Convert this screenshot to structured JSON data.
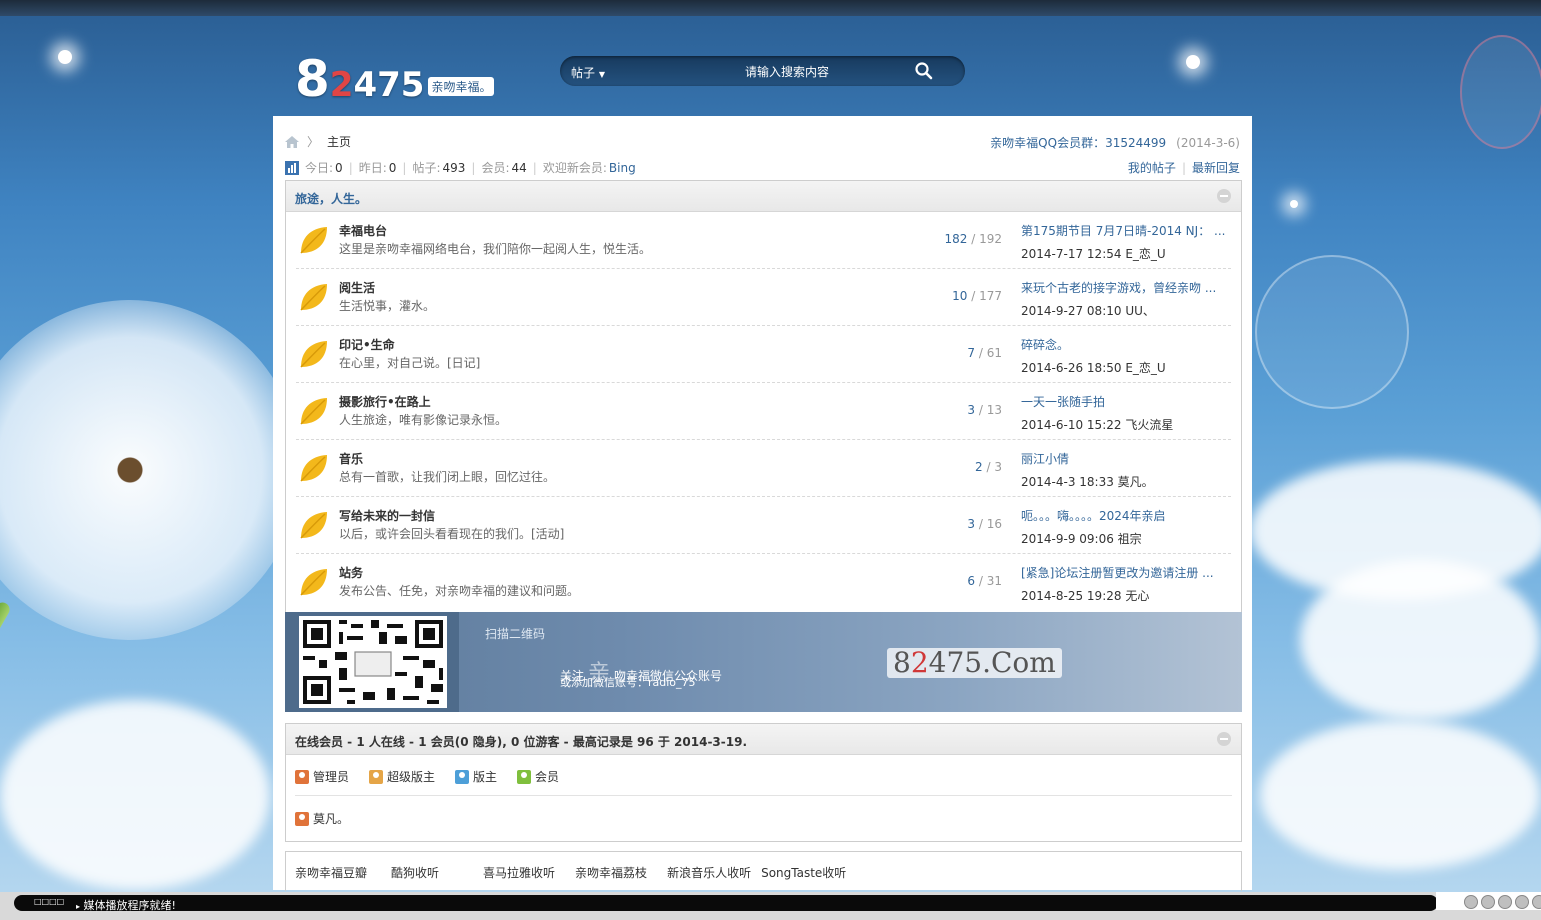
{
  "logo": {
    "digit_big": "8",
    "digit_red": "2",
    "digits_rest": "475",
    "tagline": "亲吻幸福。"
  },
  "search": {
    "type_label": "帖子",
    "placeholder": "请输入搜索内容"
  },
  "breadcrumb": {
    "home_label": "主页"
  },
  "qq_group": {
    "text": "亲吻幸福QQ会员群：31524499",
    "date": "(2014-3-6)"
  },
  "stats": {
    "today_label": "今日:",
    "today": "0",
    "yesterday_label": "昨日:",
    "yesterday": "0",
    "posts_label": "帖子:",
    "posts": "493",
    "members_label": "会员:",
    "members": "44",
    "welcome_label": "欢迎新会员:",
    "newest": "Bing"
  },
  "user_links": {
    "my_posts": "我的帖子",
    "latest_replies": "最新回复"
  },
  "category": {
    "title": "旅途，人生。",
    "forums": [
      {
        "name": "幸福电台",
        "desc": "这里是亲吻幸福网络电台，我们陪你一起阅人生，悦生活。",
        "threads": "182",
        "posts": "192",
        "last_title": "第175期节目 7月7日晴-2014 NJ： ...",
        "last_info": "2014-7-17 12:54 E_恋_U"
      },
      {
        "name": "阅生活",
        "desc": "生活悦事，灌水。",
        "threads": "10",
        "posts": "177",
        "last_title": "来玩个古老的接字游戏，曾经亲吻 ...",
        "last_info": "2014-9-27 08:10 UU、"
      },
      {
        "name": "印记•生命",
        "desc": "在心里，对自己说。[日记]",
        "threads": "7",
        "posts": "61",
        "last_title": "碎碎念。",
        "last_info": "2014-6-26 18:50 E_恋_U"
      },
      {
        "name": "摄影旅行•在路上",
        "desc": "人生旅途，唯有影像记录永恒。",
        "threads": "3",
        "posts": "13",
        "last_title": "一天一张随手拍",
        "last_info": "2014-6-10 15:22 飞火流星"
      },
      {
        "name": "音乐",
        "desc": "总有一首歌，让我们闭上眼，回忆过往。",
        "threads": "2",
        "posts": "3",
        "last_title": "丽江小倩",
        "last_info": "2014-4-3 18:33 莫凡。"
      },
      {
        "name": "写给未来的一封信",
        "desc": "以后，或许会回头看看现在的我们。[活动]",
        "threads": "3",
        "posts": "16",
        "last_title": "呃。。。嗨。。。。2024年亲启",
        "last_info": "2014-9-9 09:06 祖宗"
      },
      {
        "name": "站务",
        "desc": "发布公告、任免，对亲吻幸福的建议和问题。",
        "threads": "6",
        "posts": "31",
        "last_title": "[紧急]论坛注册暂更改为邀请注册 ...",
        "last_info": "2014-8-25 19:28 无心"
      }
    ]
  },
  "banner": {
    "scan": "扫描二维码",
    "line1_a": "关注",
    "line1_b": "亲",
    "line1_c": "吻幸福微信公众账号",
    "line2": "或添加微信账号：radio_75",
    "site_a": "8",
    "site_red": "2",
    "site_b": "475.Com"
  },
  "online": {
    "title": "在线会员 - 1 人在线 - 1 会员(0 隐身), 0 位游客 - 最高记录是 96 于 2014-3-19.",
    "roles": [
      {
        "label": "管理员",
        "color": "#e0733a"
      },
      {
        "label": "超级版主",
        "color": "#e5a547"
      },
      {
        "label": "版主",
        "color": "#4d9fd8"
      },
      {
        "label": "会员",
        "color": "#7fbf3d"
      }
    ],
    "users": [
      "莫凡。"
    ]
  },
  "friend_links": [
    "亲吻幸福豆瓣",
    "酷狗收听",
    "喜马拉雅收听",
    "亲吻幸福荔枝",
    "新浪音乐人收听",
    "SongTaste收听"
  ],
  "player": {
    "mode": "□□□□",
    "status": "媒体播放程序就绪!"
  },
  "colors": {
    "link": "#336699",
    "accent_red": "#e04545",
    "leaf": "#f3b81b"
  }
}
